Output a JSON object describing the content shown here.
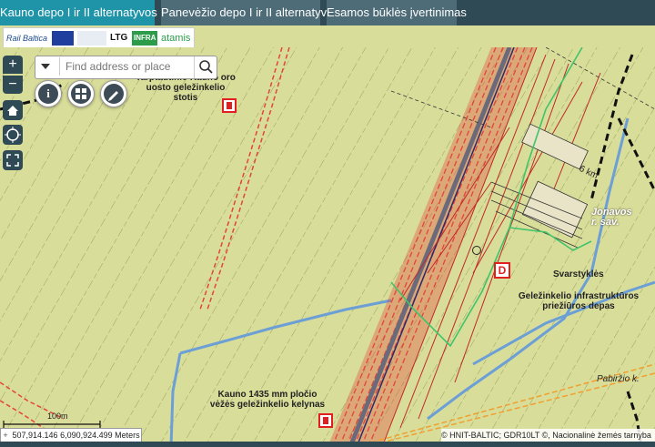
{
  "tabs": [
    {
      "label": "Kauno depo I ir II alternatyvos",
      "active": true
    },
    {
      "label": "Panevėžio depo I ir II alternatyvos",
      "active": false
    },
    {
      "label": "Esamos būklės įvertinimas",
      "active": false
    }
  ],
  "logos": {
    "rail_baltica": "Rail Baltica",
    "ltg": "LTG",
    "infra": "INFRA",
    "atamis": "atamis"
  },
  "controls": {
    "zoom_in": "+",
    "zoom_out": "−"
  },
  "search": {
    "placeholder": "Find address or place"
  },
  "labels": {
    "station": "Tarptautinio Kauno oro\nuosto geležinkelio stotis",
    "jonavos": "Jonavos\nr. sav.",
    "svarstykles": "Svarstyklės",
    "depas": "Geležinkelio infrastruktūros\npriežiūros depas",
    "kelynas": "Kauno 1435 mm pločio\nvėžės geležinkelio kelynas",
    "pabirzio": "Pabiržio k.",
    "distance": "6 km",
    "depot_marker": "D"
  },
  "scale": {
    "label": "100m"
  },
  "coordinates": "507,914.146 6,090,924.499 Meters",
  "attribution": "© HNIT-BALTIC; GDR10LT ©, Nacionalinė žemės tarnyba",
  "colors": {
    "tab_active": "#1f93a8",
    "tab_inactive": "#4d6c78",
    "map_background": "#d9dd9a",
    "rail_red": "#e2453a",
    "water_blue": "#6b9fd6",
    "green_line": "#3fc46a",
    "orange_dashed": "#f0a030",
    "depot_marker": "#e02020"
  }
}
